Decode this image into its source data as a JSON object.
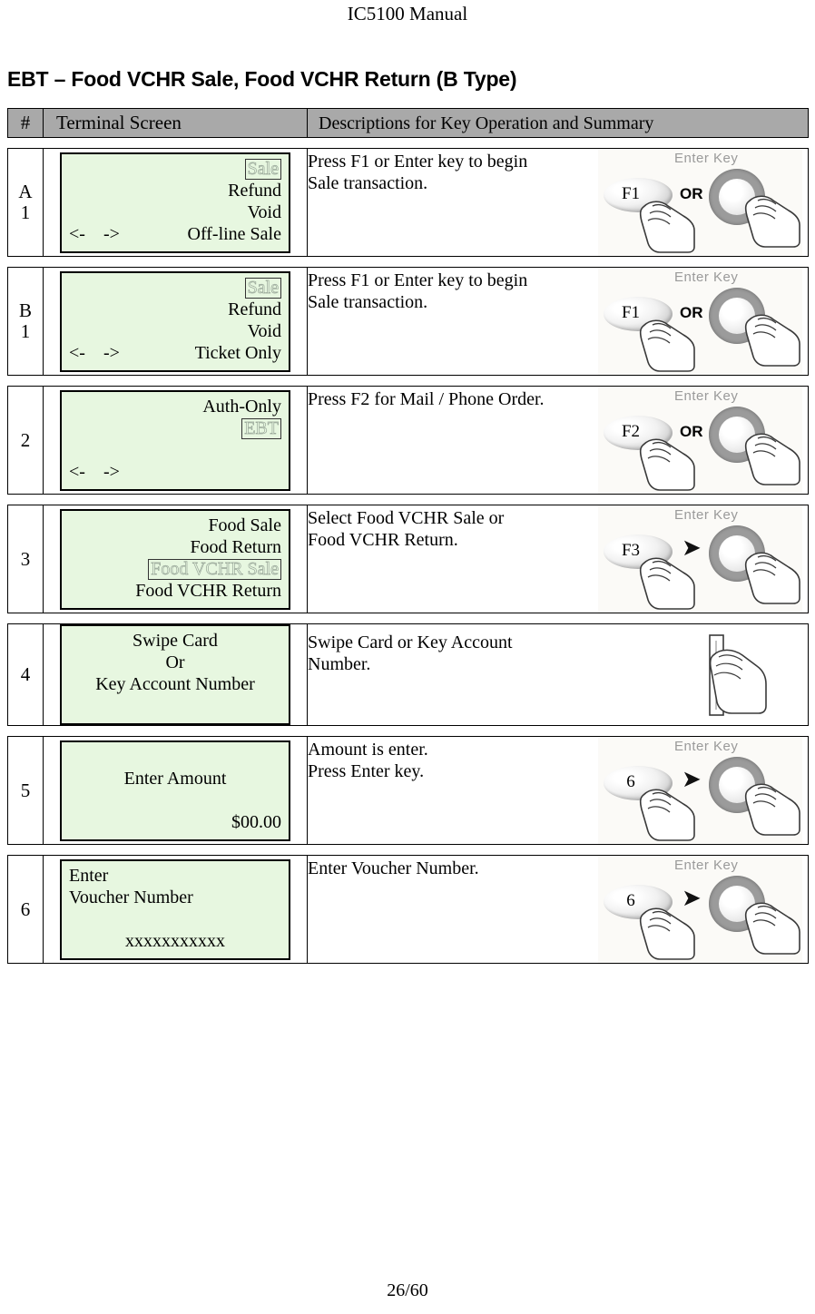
{
  "document": {
    "header_title": "IC5100 Manual",
    "section_title": "EBT – Food VCHR Sale, Food VCHR Return (B Type)",
    "page_footer": "26/60"
  },
  "table": {
    "headers": {
      "number": "#",
      "terminal_screen": "Terminal Screen",
      "descriptions": "Descriptions for Key Operation and Summary"
    },
    "rows": [
      {
        "number": "A\n1",
        "screen": {
          "lines": [
            {
              "align": "right",
              "text": "Sale",
              "highlight": true
            },
            {
              "align": "right",
              "text": "Refund",
              "highlight": false
            },
            {
              "align": "right",
              "text": "Void",
              "highlight": false
            },
            {
              "align": "nav",
              "arrows": "<-    ->",
              "text": "Off-line Sale",
              "highlight": false
            }
          ]
        },
        "description": "Press F1 or Enter key to begin\nSale transaction.",
        "figure": {
          "type": "key-or-enter",
          "key_label": "F1",
          "connector": "OR",
          "enter_label": "Enter Key"
        }
      },
      {
        "number": "B\n1",
        "screen": {
          "lines": [
            {
              "align": "right",
              "text": "Sale",
              "highlight": true
            },
            {
              "align": "right",
              "text": "Refund",
              "highlight": false
            },
            {
              "align": "right",
              "text": "Void",
              "highlight": false
            },
            {
              "align": "nav",
              "arrows": "<-    ->",
              "text": "Ticket Only",
              "highlight": false
            }
          ]
        },
        "description": "Press F1 or Enter key to begin\nSale transaction.",
        "figure": {
          "type": "key-or-enter",
          "key_label": "F1",
          "connector": "OR",
          "enter_label": "Enter Key"
        }
      },
      {
        "number": "2",
        "screen": {
          "lines": [
            {
              "align": "right",
              "text": "Auth-Only",
              "highlight": false
            },
            {
              "align": "right",
              "text": "EBT",
              "highlight": true
            },
            {
              "align": "blank",
              "text": "",
              "highlight": false
            },
            {
              "align": "nav",
              "arrows": "<-    ->",
              "text": "",
              "highlight": false
            }
          ]
        },
        "description": "Press F2 for Mail / Phone Order.",
        "figure": {
          "type": "key-or-enter",
          "key_label": "F2",
          "connector": "OR",
          "enter_label": "Enter Key"
        }
      },
      {
        "number": "3",
        "screen": {
          "lines": [
            {
              "align": "right",
              "text": "Food Sale",
              "highlight": false
            },
            {
              "align": "right",
              "text": "Food Return",
              "highlight": false
            },
            {
              "align": "right",
              "text": "Food VCHR Sale",
              "highlight": true
            },
            {
              "align": "right",
              "text": "Food VCHR Return",
              "highlight": false
            }
          ]
        },
        "description": "Select Food VCHR Sale or\nFood VCHR Return.",
        "figure": {
          "type": "key-arrow-enter",
          "key_label": "F3",
          "connector": "arrow",
          "enter_label": "Enter Key"
        }
      },
      {
        "number": "4",
        "screen": {
          "lines": [
            {
              "align": "center",
              "text": "Swipe Card",
              "highlight": false
            },
            {
              "align": "center",
              "text": "Or",
              "highlight": false
            },
            {
              "align": "center",
              "text": "Key Account Number",
              "highlight": false
            },
            {
              "align": "blank",
              "text": "",
              "highlight": false
            }
          ]
        },
        "description": "Swipe Card or Key Account\nNumber.",
        "figure": {
          "type": "card-swipe"
        }
      },
      {
        "number": "5",
        "screen": {
          "lines": [
            {
              "align": "blank",
              "text": "",
              "highlight": false
            },
            {
              "align": "center",
              "text": "Enter Amount",
              "highlight": false
            },
            {
              "align": "blank",
              "text": "",
              "highlight": false
            },
            {
              "align": "right",
              "text": "$00.00",
              "highlight": false
            }
          ]
        },
        "description": "Amount is enter.\nPress Enter key.",
        "figure": {
          "type": "key-arrow-enter",
          "key_label": "6",
          "connector": "arrow",
          "enter_label": "Enter Key"
        }
      },
      {
        "number": "6",
        "screen": {
          "lines": [
            {
              "align": "left",
              "text": "Enter",
              "highlight": false
            },
            {
              "align": "left",
              "text": "Voucher Number",
              "highlight": false
            },
            {
              "align": "blank",
              "text": "",
              "highlight": false
            },
            {
              "align": "center",
              "text": "xxxxxxxxxxx",
              "highlight": false
            }
          ]
        },
        "description": "Enter Voucher Number.",
        "figure": {
          "type": "key-arrow-enter",
          "key_label": "6",
          "connector": "arrow",
          "enter_label": "Enter Key"
        }
      }
    ]
  },
  "colors": {
    "lcd_background": "#e7f7e0",
    "header_background": "#a9a9a9",
    "border": "#000000"
  }
}
